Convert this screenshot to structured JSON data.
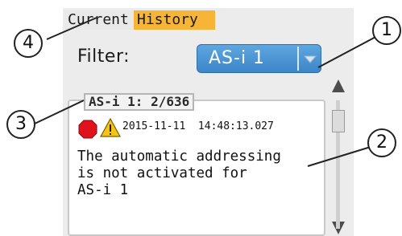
{
  "tabs": {
    "current_label": "Current",
    "history_label": "History"
  },
  "filter": {
    "label": "Filter:",
    "selected": "AS-i 1"
  },
  "group": {
    "title": "AS-i 1: 2/636"
  },
  "event": {
    "timestamp": "2015-11-11  14:48:13.027",
    "message": "The automatic addressing\nis not activated for\nAS-i 1",
    "icons": [
      "stop-icon",
      "warning-icon"
    ]
  },
  "callouts": {
    "c1": "1",
    "c2": "2",
    "c3": "3",
    "c4": "4"
  },
  "colors": {
    "history_tab": "#f7b538",
    "dropdown": "#4a93d4",
    "stop": "#e0121b",
    "warning": "#f3c318"
  }
}
